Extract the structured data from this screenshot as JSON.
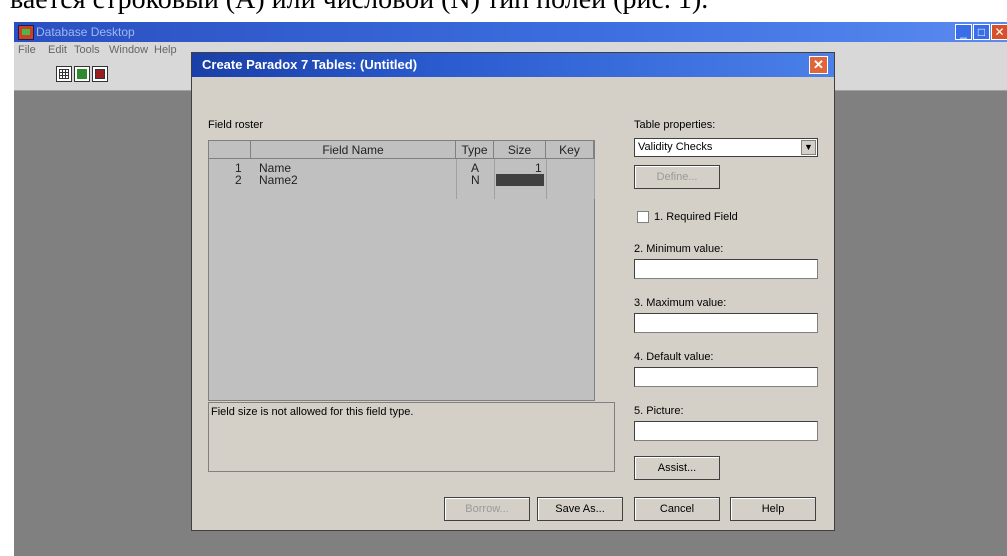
{
  "document": {
    "caption_fragment": "вается строковый (A) или числовой (N) тип полей (рис. 1)."
  },
  "app": {
    "title": "Database Desktop",
    "menu": [
      "File",
      "Edit",
      "Tools",
      "Window",
      "Help"
    ],
    "window_buttons": [
      "minimize",
      "maximize",
      "close"
    ]
  },
  "dialog": {
    "title": "Create Paradox 7 Tables: (Untitled)",
    "field_roster_label": "Field roster",
    "columns": [
      "Field Name",
      "Type",
      "Size",
      "Key"
    ],
    "rows": [
      {
        "num": "1",
        "name": "Name",
        "type": "A",
        "size": "1",
        "key": ""
      },
      {
        "num": "2",
        "name": "Name2",
        "type": "N",
        "size": "",
        "key": ""
      }
    ],
    "message": "Field size is not allowed for this field type.",
    "table_properties_label": "Table properties:",
    "table_properties_value": "Validity Checks",
    "define_button": "Define...",
    "required_field_label": "1. Required Field",
    "min_label": "2. Minimum value:",
    "max_label": "3. Maximum value:",
    "default_label": "4. Default value:",
    "picture_label": "5. Picture:",
    "assist_button": "Assist...",
    "borrow_button": "Borrow...",
    "save_as_button": "Save As...",
    "cancel_button": "Cancel",
    "help_button": "Help"
  }
}
